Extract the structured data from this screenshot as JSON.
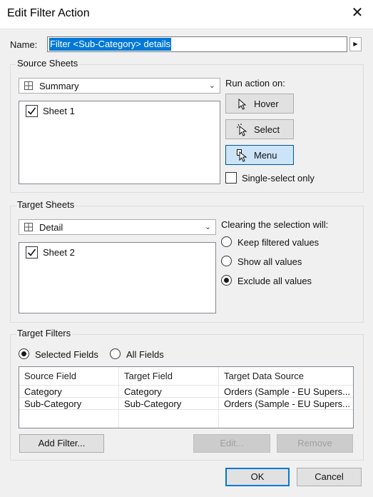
{
  "window": {
    "title": "Edit Filter Action",
    "close_glyph": "✕"
  },
  "name": {
    "label": "Name:",
    "value": "Filter <Sub-Category> details",
    "menu_arrow": "▶"
  },
  "source": {
    "group_label": "Source Sheets",
    "dropdown_value": "Summary",
    "sheets": [
      {
        "label": "Sheet 1",
        "checked": true
      }
    ],
    "run_action_label": "Run action on:",
    "buttons": {
      "hover": "Hover",
      "select": "Select",
      "menu": "Menu"
    },
    "active_button": "menu",
    "single_select_label": "Single-select only",
    "single_select_checked": false
  },
  "target": {
    "group_label": "Target Sheets",
    "dropdown_value": "Detail",
    "sheets": [
      {
        "label": "Sheet 2",
        "checked": true
      }
    ],
    "clearing_label": "Clearing the selection will:",
    "options": [
      "Keep filtered values",
      "Show all values",
      "Exclude all values"
    ],
    "selected_option": 2
  },
  "filters": {
    "group_label": "Target Filters",
    "radio_selected": "Selected Fields",
    "radio_all": "All Fields",
    "columns": [
      "Source Field",
      "Target Field",
      "Target Data Source"
    ],
    "rows": [
      [
        "Category",
        "Category",
        "Orders (Sample - EU Supers..."
      ],
      [
        "Sub-Category",
        "Sub-Category",
        "Orders (Sample - EU Supers..."
      ]
    ],
    "add_button": "Add Filter...",
    "edit_button": "Edit...",
    "remove_button": "Remove"
  },
  "footer": {
    "ok": "OK",
    "cancel": "Cancel"
  },
  "colors": {
    "accent": "#0078d7",
    "active_button_bg": "#cce4f7",
    "selection": "#0078d7"
  },
  "icons": [
    "grid-icon",
    "checkmark-icon",
    "pointer-icon",
    "select-pointer-icon",
    "menu-pointer-icon",
    "chevron-down-icon",
    "close-icon",
    "play-arrow-icon"
  ]
}
